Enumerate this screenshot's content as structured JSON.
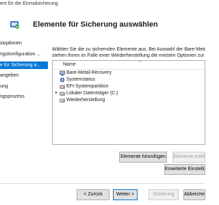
{
  "window": {
    "title": "ent für die Einmalsicherung"
  },
  "header": {
    "title": "Elemente für Sicherung auswählen",
    "icon": "backup-wizard-icon"
  },
  "nav": {
    "items": [
      {
        "label": "sioptionen",
        "active": false
      },
      {
        "label": "ngskonfiguration ...",
        "active": false
      },
      {
        "label": "e für Sicherung a...",
        "active": true
      },
      {
        "label": "angeben",
        "active": false
      },
      {
        "label": "ung",
        "active": false
      },
      {
        "label": "ngsprozess",
        "active": false
      }
    ]
  },
  "content": {
    "description_line1": "Wählen Sie die zu sichernden Elemente aus. Bei Auswahl der Bare-Metal-Recove",
    "description_line2": "stehen Ihnen im Falle einer Wiederherstellung die meisten Optionen zur Verfüg",
    "list": {
      "column_header": "Name",
      "items": [
        {
          "label": "Bare-Metal-Recovery",
          "icon": "bare-metal-recovery-icon"
        },
        {
          "label": "Systemstatus",
          "icon": "system-state-icon"
        },
        {
          "label": "EFI-Systempartition",
          "icon": "efi-partition-icon"
        },
        {
          "label": "Lokaler Datenträger (C:)",
          "icon": "disk-drive-icon"
        },
        {
          "label": "Wiederherstellung",
          "icon": "recovery-drive-icon"
        }
      ]
    },
    "buttons": {
      "add_items": "Elemente hinzufügen",
      "remove_items": "Elemente entfe",
      "advanced_settings": "Erweiterte Einstellun"
    }
  },
  "footer": {
    "back": "< Zurück",
    "next": "Weiter >",
    "backup": "Sicherung",
    "cancel": "Abbreche"
  },
  "colors": {
    "accent": "#0078d7"
  }
}
